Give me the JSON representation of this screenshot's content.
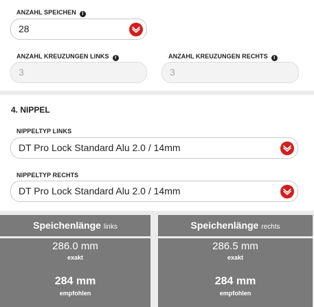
{
  "spokes": {
    "count_label": "ANZAHL SPEICHEN",
    "count_value": "28",
    "cross_left_label": "ANZAHL KREUZUNGEN LINKS",
    "cross_left_value": "3",
    "cross_right_label": "ANZAHL KREUZUNGEN RECHTS",
    "cross_right_value": "3"
  },
  "nipple": {
    "section_title": "4. NIPPEL",
    "left_label": "NIPPELTYP LINKS",
    "left_value": "DT Pro Lock Standard Alu 2.0 / 14mm",
    "right_label": "NIPPELTYP RECHTS",
    "right_value": "DT Pro Lock Standard Alu 2.0 / 14mm"
  },
  "results": {
    "left": {
      "title": "Speichenlänge",
      "side": "links",
      "exact_value": "286.0 mm",
      "exact_caption": "exakt",
      "recommended_value": "284 mm",
      "recommended_caption": "empfohlen"
    },
    "right": {
      "title": "Speichenlänge",
      "side": "rechts",
      "exact_value": "286.5 mm",
      "exact_caption": "exakt",
      "recommended_value": "284 mm",
      "recommended_caption": "empfohlen"
    }
  },
  "colors": {
    "accent": "#d21f1f",
    "card_bg": "#7a7a7a",
    "page_bg": "#ebebeb"
  },
  "icons": {
    "info": "info-icon",
    "dropdown": "chevron-down-icon"
  }
}
